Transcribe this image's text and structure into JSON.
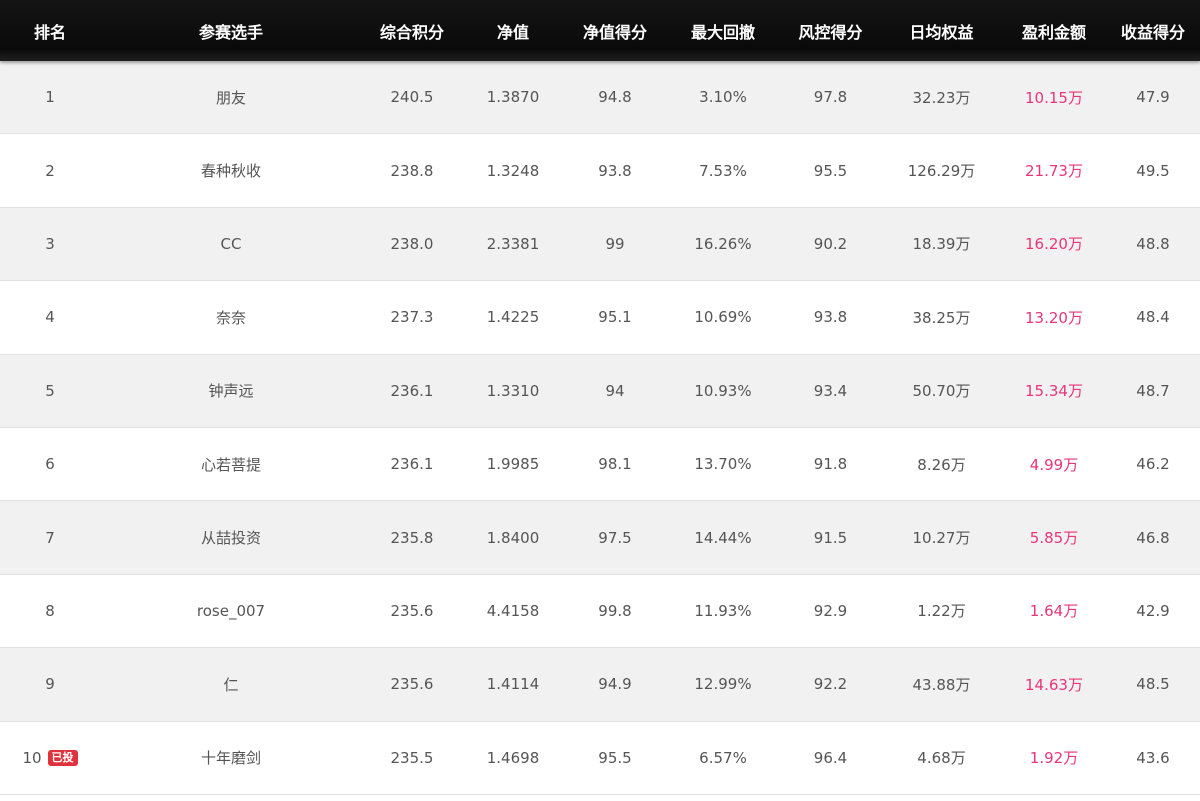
{
  "header": {
    "columns": [
      "排名",
      "参赛选手",
      "综合积分",
      "净值",
      "净值得分",
      "最大回撤",
      "风控得分",
      "日均权益",
      "盈利金额",
      "收益得分"
    ]
  },
  "rows": [
    {
      "rank": "1",
      "name": "朋友",
      "score": "240.5",
      "nav": "1.3870",
      "nav_score": "94.8",
      "drawdown": "3.10%",
      "risk_score": "97.8",
      "equity": "32.23万",
      "profit": "10.15万",
      "return_score": "47.9"
    },
    {
      "rank": "2",
      "name": "春种秋收",
      "score": "238.8",
      "nav": "1.3248",
      "nav_score": "93.8",
      "drawdown": "7.53%",
      "risk_score": "95.5",
      "equity": "126.29万",
      "profit": "21.73万",
      "return_score": "49.5"
    },
    {
      "rank": "3",
      "name": "CC",
      "score": "238.0",
      "nav": "2.3381",
      "nav_score": "99",
      "drawdown": "16.26%",
      "risk_score": "90.2",
      "equity": "18.39万",
      "profit": "16.20万",
      "return_score": "48.8"
    },
    {
      "rank": "4",
      "name": "奈奈",
      "score": "237.3",
      "nav": "1.4225",
      "nav_score": "95.1",
      "drawdown": "10.69%",
      "risk_score": "93.8",
      "equity": "38.25万",
      "profit": "13.20万",
      "return_score": "48.4"
    },
    {
      "rank": "5",
      "name": "钟声远",
      "score": "236.1",
      "nav": "1.3310",
      "nav_score": "94",
      "drawdown": "10.93%",
      "risk_score": "93.4",
      "equity": "50.70万",
      "profit": "15.34万",
      "return_score": "48.7"
    },
    {
      "rank": "6",
      "name": "心若菩提",
      "score": "236.1",
      "nav": "1.9985",
      "nav_score": "98.1",
      "drawdown": "13.70%",
      "risk_score": "91.8",
      "equity": "8.26万",
      "profit": "4.99万",
      "return_score": "46.2"
    },
    {
      "rank": "7",
      "name": "从喆投资",
      "score": "235.8",
      "nav": "1.8400",
      "nav_score": "97.5",
      "drawdown": "14.44%",
      "risk_score": "91.5",
      "equity": "10.27万",
      "profit": "5.85万",
      "return_score": "46.8"
    },
    {
      "rank": "8",
      "name": "rose_007",
      "score": "235.6",
      "nav": "4.4158",
      "nav_score": "99.8",
      "drawdown": "11.93%",
      "risk_score": "92.9",
      "equity": "1.22万",
      "profit": "1.64万",
      "return_score": "42.9"
    },
    {
      "rank": "9",
      "name": "仁",
      "score": "235.6",
      "nav": "1.4114",
      "nav_score": "94.9",
      "drawdown": "12.99%",
      "risk_score": "92.2",
      "equity": "43.88万",
      "profit": "14.63万",
      "return_score": "48.5"
    },
    {
      "rank": "10",
      "badge": "已投",
      "name": "十年磨剑",
      "score": "235.5",
      "nav": "1.4698",
      "nav_score": "95.5",
      "drawdown": "6.57%",
      "risk_score": "96.4",
      "equity": "4.68万",
      "profit": "1.92万",
      "return_score": "43.6"
    }
  ],
  "colors": {
    "header_bg": "#0f0f0f",
    "row_alt_bg": "#f1f1f1",
    "text": "#555555",
    "profit_text": "#e8357a",
    "badge_bg": "#e0323c"
  }
}
